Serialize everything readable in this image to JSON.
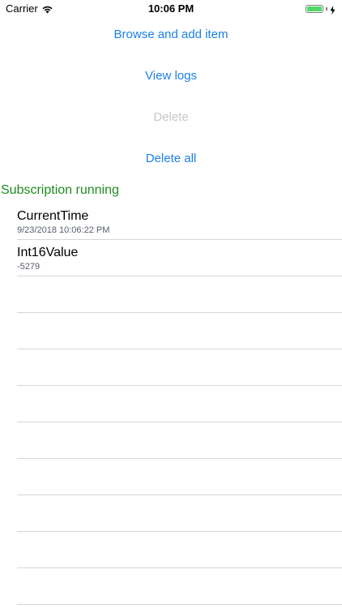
{
  "status_bar": {
    "carrier": "Carrier",
    "time": "10:06 PM",
    "battery_color": "#4cd964"
  },
  "actions": {
    "browse_label": "Browse and add item",
    "view_logs_label": "View logs",
    "delete_label": "Delete",
    "delete_all_label": "Delete all",
    "accent_color": "#1a82e6"
  },
  "subscription": {
    "status": "Subscription running",
    "color": "#1e8c1e"
  },
  "items": [
    {
      "title": "CurrentTime",
      "detail": "9/23/2018 10:06:22 PM"
    },
    {
      "title": "Int16Value",
      "detail": "-5279"
    },
    {
      "title": "",
      "detail": ""
    },
    {
      "title": "",
      "detail": ""
    },
    {
      "title": "",
      "detail": ""
    },
    {
      "title": "",
      "detail": ""
    },
    {
      "title": "",
      "detail": ""
    },
    {
      "title": "",
      "detail": ""
    },
    {
      "title": "",
      "detail": ""
    },
    {
      "title": "",
      "detail": ""
    },
    {
      "title": "",
      "detail": ""
    }
  ]
}
